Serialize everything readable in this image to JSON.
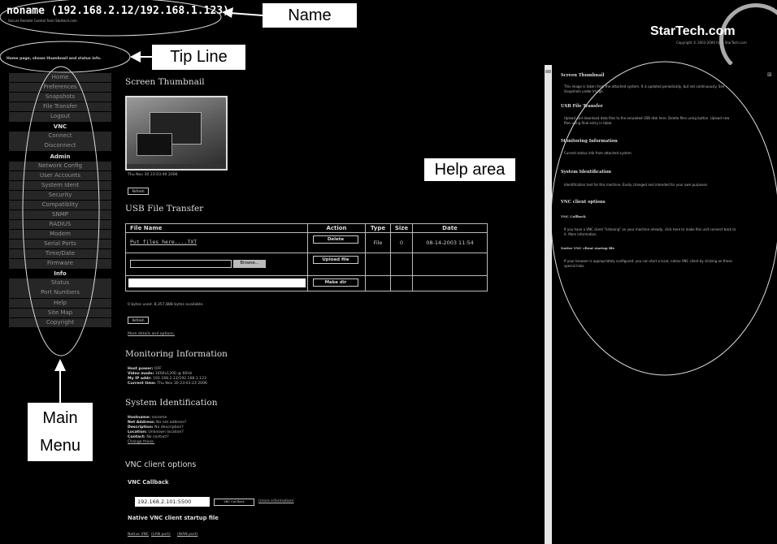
{
  "header": {
    "title": "noname (192.168.2.12/192.168.1.123)",
    "subtitle": "Secure Remote Control from Startech.com",
    "tip": "Home page, shows thumbnail and status info."
  },
  "logo": {
    "text": "StarTech.com",
    "copyright": "Copyright © 2003-2006 from StarTech.com"
  },
  "callouts": {
    "name": "Name",
    "tip": "Tip Line",
    "help": "Help area",
    "menu": "Main Menu"
  },
  "sidebar": {
    "items": [
      {
        "type": "item",
        "label": "Home"
      },
      {
        "type": "item",
        "label": "Preferences"
      },
      {
        "type": "item",
        "label": "Snapshots"
      },
      {
        "type": "item",
        "label": "File Transfer"
      },
      {
        "type": "item",
        "label": "Logout"
      },
      {
        "type": "section",
        "label": "VNC"
      },
      {
        "type": "item",
        "label": "Connect"
      },
      {
        "type": "item",
        "label": "Disconnect"
      },
      {
        "type": "section",
        "label": "Admin"
      },
      {
        "type": "item",
        "label": "Network Config"
      },
      {
        "type": "item",
        "label": "User Accounts"
      },
      {
        "type": "item",
        "label": "System Ident"
      },
      {
        "type": "item",
        "label": "Security"
      },
      {
        "type": "item",
        "label": "Compatiblity"
      },
      {
        "type": "item",
        "label": "SNMP"
      },
      {
        "type": "item",
        "label": "RADIUS"
      },
      {
        "type": "item",
        "label": "Modem"
      },
      {
        "type": "item",
        "label": "Serial Ports"
      },
      {
        "type": "item",
        "label": "Time/Date"
      },
      {
        "type": "item",
        "label": "Firmware"
      },
      {
        "type": "section",
        "label": "Info"
      },
      {
        "type": "item",
        "label": "Status"
      },
      {
        "type": "item",
        "label": "Port Numbers"
      },
      {
        "type": "item",
        "label": "Help"
      },
      {
        "type": "item",
        "label": "Site Map"
      },
      {
        "type": "item",
        "label": "Copyright"
      }
    ]
  },
  "main": {
    "thumb_heading": "Screen Thumbnail",
    "thumb_time": "Thu Nov 30 23:03:00 2006",
    "refresh_label": "Refresh",
    "usb_heading": "USB File Transfer",
    "usb_table": {
      "headers": [
        "File Name",
        "Action",
        "Type",
        "Size",
        "Date"
      ],
      "file_name": "Put files here....TXT",
      "delete_label": "Delete",
      "file_type": "File",
      "file_size": "0",
      "file_date": "08-14-2003 11:54",
      "browse_label": "Browse...",
      "upload_label": "Upload file",
      "make_dir_label": "Make dir"
    },
    "usb_usage": "0 bytes used. 8,357,888 bytes available.",
    "more_details": "More details and options.",
    "monitoring_heading": "Monitoring Information",
    "monitoring": [
      {
        "key": "Host power:",
        "value": "OFF"
      },
      {
        "key": "Video mode:",
        "value": "1600x1200 @ 60Hz"
      },
      {
        "key": "My IP addr:",
        "value": "192.168.2.12/192.168.1.123"
      },
      {
        "key": "Current time:",
        "value": "Thu Nov 30 23:03:23 2006"
      }
    ],
    "sysid_heading": "System Identification",
    "sysid": [
      {
        "key": "Hostname:",
        "value": "noname"
      },
      {
        "key": "Net Address:",
        "value": "No net address?"
      },
      {
        "key": "Description:",
        "value": "No description?"
      },
      {
        "key": "Location:",
        "value": "Unknown location?"
      },
      {
        "key": "Contact:",
        "value": "No contact?"
      }
    ],
    "change_these": "Change these.",
    "vnc_heading": "VNC client options",
    "vnc_callback_heading": "VNC Callback",
    "vnc_host_value": "192.168.2.101:5500",
    "vnc_callback_button": "VNC Call Back",
    "more_information": "(more information)",
    "native_heading": "Native VNC client startup file",
    "native_links": [
      "Native VNC",
      "(LAN port)",
      "(WAN port)"
    ]
  },
  "help": {
    "close_glyph": "⊠",
    "sections": [
      {
        "heading": "Screen Thumbnail",
        "lines": [
          "This image is taken from the attached system. It is updated periodically, but not continuously. See",
          "Snapshots under Image."
        ]
      },
      {
        "heading": "USB File Transfer",
        "lines": [
          "Upload and download data files to the emulated USB disk here. Delete files using button. Upload new",
          "files using final entry in table."
        ]
      },
      {
        "heading": "Monitoring Information",
        "lines": [
          "Current status info from attached system."
        ]
      },
      {
        "heading": "System Identification",
        "lines": [
          "Identification text for this machine. Easily changed and intended for your own purposes."
        ]
      },
      {
        "heading": "VNC client options",
        "lines": []
      },
      {
        "heading": "VNC Callback",
        "lines": [
          "If you have a VNC client \"listening\" on your machine already, click here to make this unit connect back to",
          "it. More information."
        ]
      },
      {
        "heading": "Native VNC client startup file",
        "lines": [
          "If your browser is appropriately configured, you can start a local, native VNC client by clicking on these",
          "special links."
        ]
      }
    ]
  },
  "colors": {
    "background": "#000000",
    "menu_item_bg": "#262626",
    "callout_bg": "#ffffff"
  }
}
